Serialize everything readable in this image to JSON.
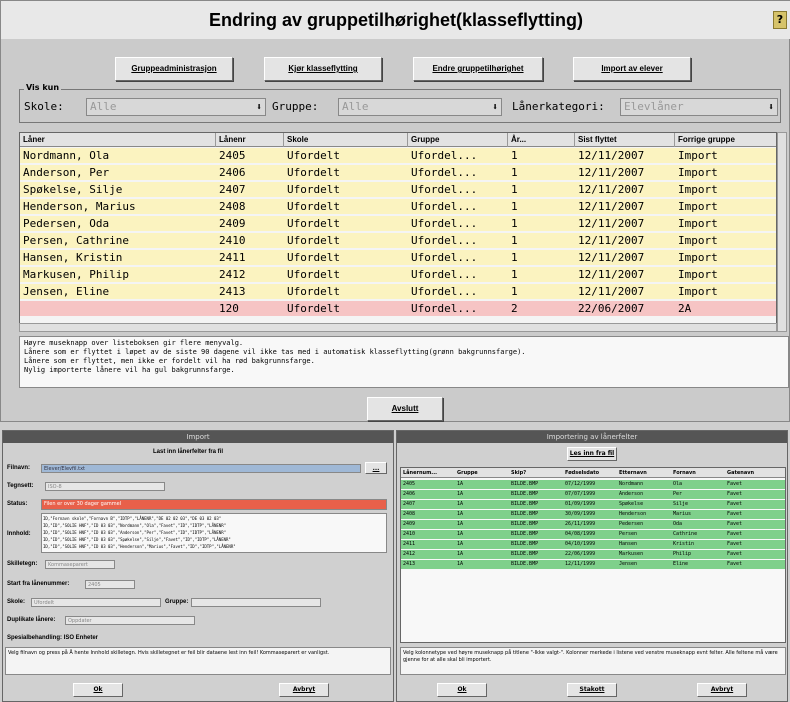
{
  "main": {
    "title": "Endring av gruppetilhørighet(klasseflytting)",
    "help_icon": "?",
    "buttons": [
      "Gruppeadministrasjon",
      "Kjør klasseflytting",
      "Endre gruppetilhørighet",
      "Import av elever"
    ],
    "filter_legend": "Vis kun",
    "filter": {
      "skole_label": "Skole:",
      "skole_value": "Alle",
      "gruppe_label": "Gruppe:",
      "gruppe_value": "Alle",
      "kategori_label": "Lånerkategori:",
      "kategori_value": "Elevlåner"
    },
    "columns": [
      "Låner",
      "Lånenr",
      "Skole",
      "Gruppe",
      "År...",
      "Sist flyttet",
      "Forrige gruppe"
    ],
    "rows": [
      {
        "laner": "Nordmann, Ola",
        "nr": "2405",
        "skole": "Ufordelt",
        "gruppe": "Ufordel...",
        "ar": "1",
        "sist": "12/11/2007",
        "forrige": "Import"
      },
      {
        "laner": "Anderson, Per",
        "nr": "2406",
        "skole": "Ufordelt",
        "gruppe": "Ufordel...",
        "ar": "1",
        "sist": "12/11/2007",
        "forrige": "Import"
      },
      {
        "laner": "Spøkelse, Silje",
        "nr": "2407",
        "skole": "Ufordelt",
        "gruppe": "Ufordel...",
        "ar": "1",
        "sist": "12/11/2007",
        "forrige": "Import"
      },
      {
        "laner": "Henderson, Marius",
        "nr": "2408",
        "skole": "Ufordelt",
        "gruppe": "Ufordel...",
        "ar": "1",
        "sist": "12/11/2007",
        "forrige": "Import"
      },
      {
        "laner": "Pedersen, Oda",
        "nr": "2409",
        "skole": "Ufordelt",
        "gruppe": "Ufordel...",
        "ar": "1",
        "sist": "12/11/2007",
        "forrige": "Import"
      },
      {
        "laner": "Persen, Cathrine",
        "nr": "2410",
        "skole": "Ufordelt",
        "gruppe": "Ufordel...",
        "ar": "1",
        "sist": "12/11/2007",
        "forrige": "Import"
      },
      {
        "laner": "Hansen, Kristin",
        "nr": "2411",
        "skole": "Ufordelt",
        "gruppe": "Ufordel...",
        "ar": "1",
        "sist": "12/11/2007",
        "forrige": "Import"
      },
      {
        "laner": "Markusen, Philip",
        "nr": "2412",
        "skole": "Ufordelt",
        "gruppe": "Ufordel...",
        "ar": "1",
        "sist": "12/11/2007",
        "forrige": "Import"
      },
      {
        "laner": "Jensen, Eline",
        "nr": "2413",
        "skole": "Ufordelt",
        "gruppe": "Ufordel...",
        "ar": "1",
        "sist": "12/11/2007",
        "forrige": "Import"
      },
      {
        "laner": "",
        "nr": "120",
        "skole": "Ufordelt",
        "gruppe": "Ufordel...",
        "ar": "2",
        "sist": "22/06/2007",
        "forrige": "2A"
      }
    ],
    "row_colors": {
      "yellow": "#fbf3c0",
      "red": "#f6c4c4"
    },
    "info": "Høyre museknapp over listeboksen gir flere menyvalg.\nLånere som er flyttet i løpet av de siste 90 dagene vil ikke tas med i automatisk klasseflytting(grønn bakgrunnsfarge).\nLånere som er flyttet, men ikke er fordelt vil ha rød bakgrunnsfarge.\nNylig importerte lånere vil ha gul bakgrunnsfarge.",
    "close_button": "Avslutt"
  },
  "import": {
    "title": "Import",
    "read_heading": "Last inn lånerfelter fra fil",
    "filnavn_label": "Filnavn:",
    "filnavn_value": "Elever/Elevfil.txt",
    "tegnsett_label": "Tegnsett:",
    "tegnsett_value": "ISO-8",
    "status_label": "Status:",
    "status_value": "Filen er over 30 dager gammel",
    "innhold_label": "Innhold:",
    "innhold_lines": [
      "ID,\"Fornavn skole\",\"Fornavn B\",\"IDTP\",\"LÅNENR\",\"DE 02 02 03\",\"DE 03 02 03\"",
      "ID,\"ID\",\"SOLIE HNF\",\"ID 03 03\",\"Nordmann\",\"Ola\",\"Favet\",\"ID\",\"IDTP\",\"LÅNENR\"",
      "ID,\"ID\",\"SOLIE HNF\",\"ID 03 03\",\"Anderson\",\"Per\",\"Favet\",\"ID\",\"IDTP\",\"LÅNENR\"",
      "ID,\"ID\",\"SOLIE HNF\",\"ID 03 03\",\"Spøkelse\",\"Silje\",\"Favet\",\"ID\",\"IDTP\",\"LÅNENR\"",
      "ID,\"ID\",\"SOLIE HNF\",\"ID 03 03\",\"Henderson\",\"Marius\",\"Favet\",\"ID\",\"IDTP\",\"LÅNENR\""
    ],
    "skilletegn_label": "Skilletegn:",
    "skilletegn_value": "Kommaseparert",
    "start_label": "Start fra lånenummer:",
    "start_value": "2405",
    "skole_label": "Skole:",
    "skole_value": "Ufordelt",
    "gruppe_label": "Gruppe:",
    "duplikate_label": "Duplikate lånere:",
    "duplikate_value": "Oppdater",
    "spesial_label": "Spesialbehandling: ISO Enheter",
    "note": "Velg filnavn og press på Å hente Innhold skilletegn. Hvis skilletegnet er feil blir dataene lest inn feil! Kommaseparert er vanligst.",
    "ok": "Ok",
    "cancel": "Avbryt"
  },
  "export": {
    "title": "Importering av lånerfelter",
    "read_button": "Les inn fra fil",
    "columns": [
      "Lånernum...",
      "Gruppe",
      "Skip?",
      "Fødselsdato",
      "Etternavn",
      "Fornavn",
      "Gatenavn"
    ],
    "rows": [
      [
        "2405",
        "1A",
        "BILDE.BMP",
        "07/12/1999",
        "Nordmann",
        "Ola",
        "Favet"
      ],
      [
        "2406",
        "1A",
        "BILDE.BMP",
        "07/07/1999",
        "Anderson",
        "Per",
        "Favet"
      ],
      [
        "2407",
        "1A",
        "BILDE.BMP",
        "01/09/1999",
        "Spøkelse",
        "Silje",
        "Favet"
      ],
      [
        "2408",
        "1A",
        "BILDE.BMP",
        "30/09/1999",
        "Henderson",
        "Marius",
        "Favet"
      ],
      [
        "2409",
        "1A",
        "BILDE.BMP",
        "26/11/1999",
        "Pedersen",
        "Oda",
        "Favet"
      ],
      [
        "2410",
        "1A",
        "BILDE.BMP",
        "04/08/1999",
        "Persen",
        "Cathrine",
        "Favet"
      ],
      [
        "2411",
        "1A",
        "BILDE.BMP",
        "04/10/1999",
        "Hansen",
        "Kristin",
        "Favet"
      ],
      [
        "2412",
        "1A",
        "BILDE.BMP",
        "22/06/1999",
        "Markusen",
        "Philip",
        "Favet"
      ],
      [
        "2413",
        "1A",
        "BILDE.BMP",
        "12/11/1999",
        "Jensen",
        "Eline",
        "Favet"
      ]
    ],
    "note": "Velg kolonnetype ved høyre museknapp på titlene \"-Ikke valgt-\". Kolonner merkede i listene ved venstre museknapp evnt felter. Alle feltene må være gjenne for at alle skal bli importert.",
    "ok": "Ok",
    "stop": "Stakott",
    "cancel": "Avbryt"
  }
}
